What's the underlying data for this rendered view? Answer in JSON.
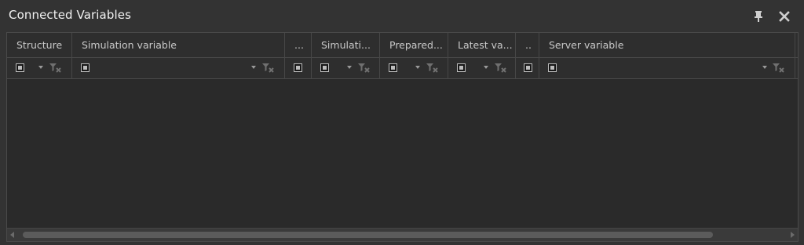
{
  "panel": {
    "title": "Connected Variables",
    "pin_icon": "pin-icon",
    "close_icon": "close-icon"
  },
  "columns": [
    {
      "label": "Structure"
    },
    {
      "label": "Simulation variable"
    },
    {
      "label": "..."
    },
    {
      "label": "Simulati..."
    },
    {
      "label": "Prepared..."
    },
    {
      "label": "Latest va..."
    },
    {
      "label": ".."
    },
    {
      "label": "Server variable"
    }
  ],
  "filter_icons": {
    "checkbox": "filter-checkbox-icon",
    "dropdown": "dropdown-arrow-icon",
    "clear_filter": "clear-filter-icon"
  },
  "colors": {
    "panel_bg": "#333333",
    "grid_bg": "#2a2a2a",
    "header_text": "#c9c9c9"
  }
}
